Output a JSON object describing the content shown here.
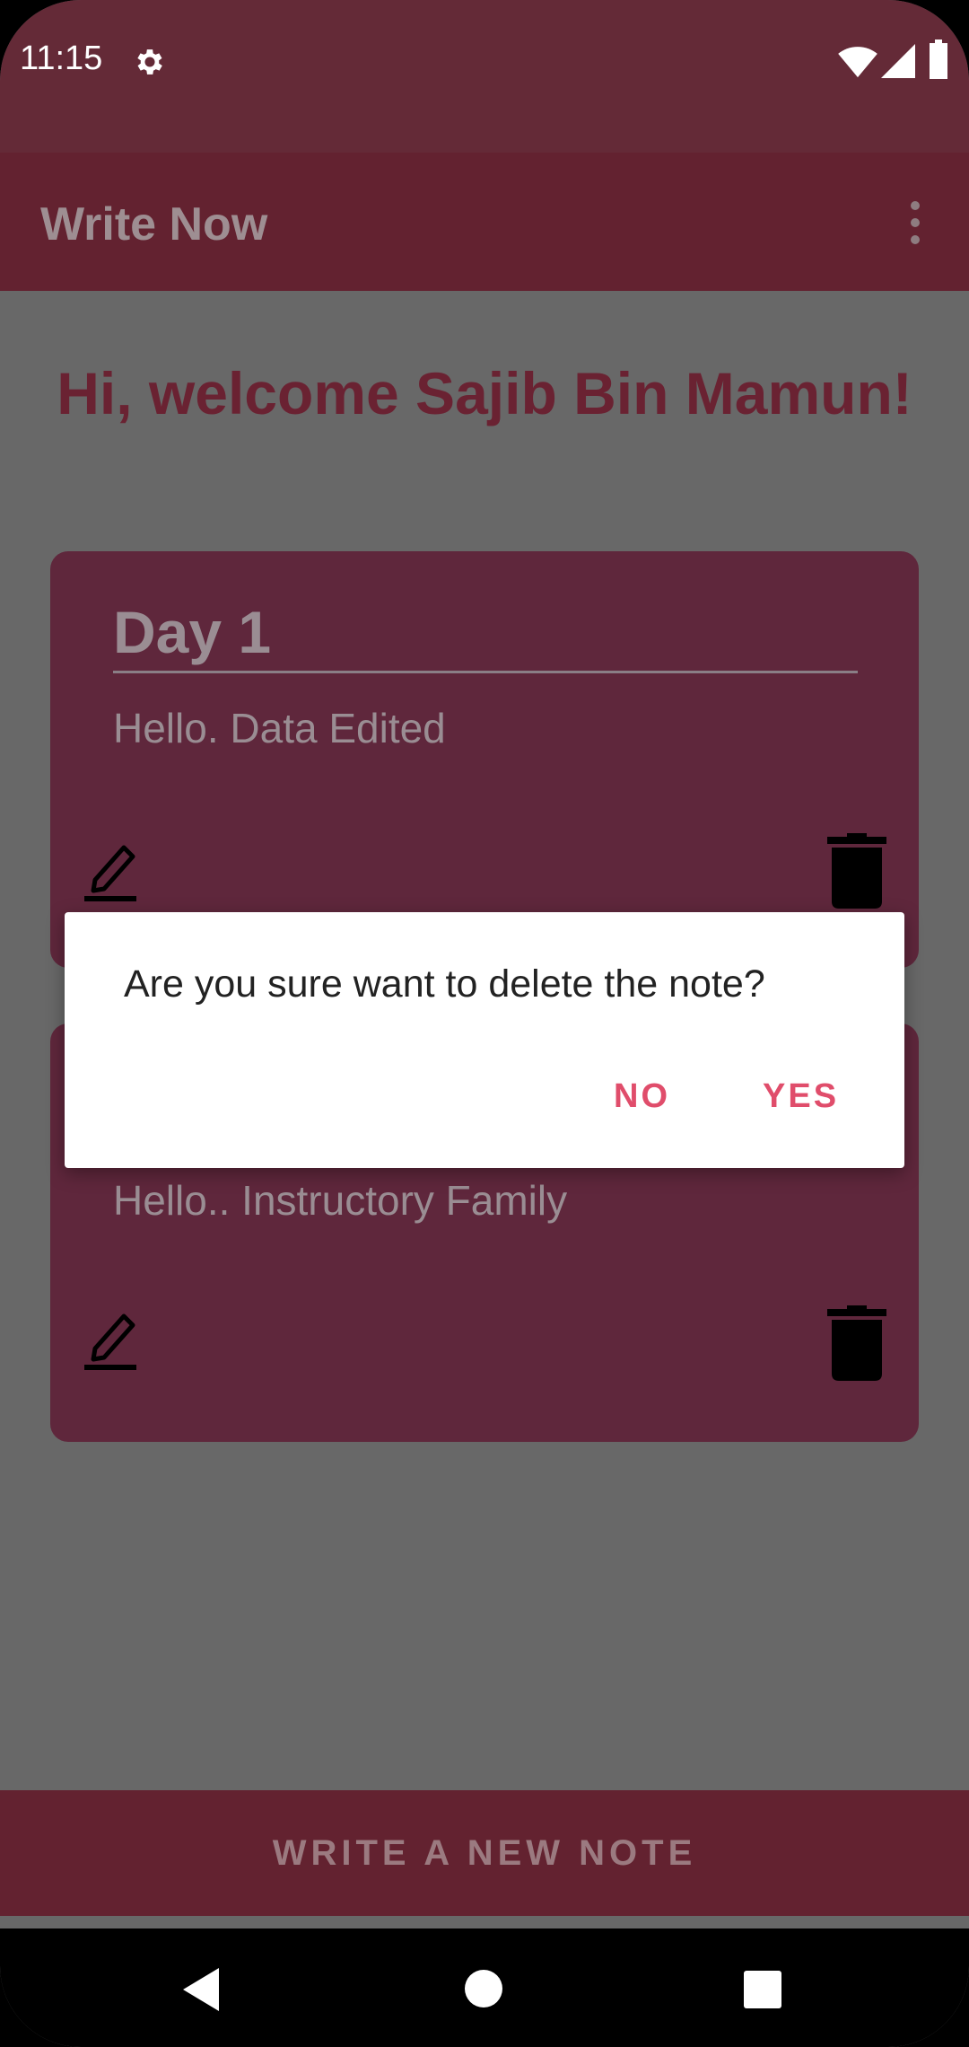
{
  "status_bar": {
    "time": "11:15",
    "icons": [
      "settings-icon",
      "wifi-icon",
      "signal-icon",
      "battery-icon"
    ]
  },
  "app_bar": {
    "title": "Write Now",
    "menu_icon": "overflow-menu-icon"
  },
  "main": {
    "welcome": "Hi, welcome Sajib Bin Mamun!",
    "notes": [
      {
        "title": "Day 1",
        "body": "Hello. Data Edited",
        "edit_icon": "edit-icon",
        "delete_icon": "trash-icon"
      },
      {
        "title": "",
        "body": "Hello.. Instructory Family",
        "edit_icon": "edit-icon",
        "delete_icon": "trash-icon"
      }
    ]
  },
  "dialog": {
    "message": "Are you sure want to delete the note?",
    "no_label": "NO",
    "yes_label": "YES"
  },
  "bottom_button": {
    "label": "WRITE A NEW NOTE"
  },
  "nav_bar": {
    "icons": [
      "back-icon",
      "home-icon",
      "recents-icon"
    ]
  },
  "colors": {
    "status_bar": "#642a37",
    "app_bar": "#632230",
    "card": "#5f273c",
    "welcome_text": "#6a2232",
    "dialog_accent": "#e04d6b",
    "scrim_background": "#686868"
  }
}
